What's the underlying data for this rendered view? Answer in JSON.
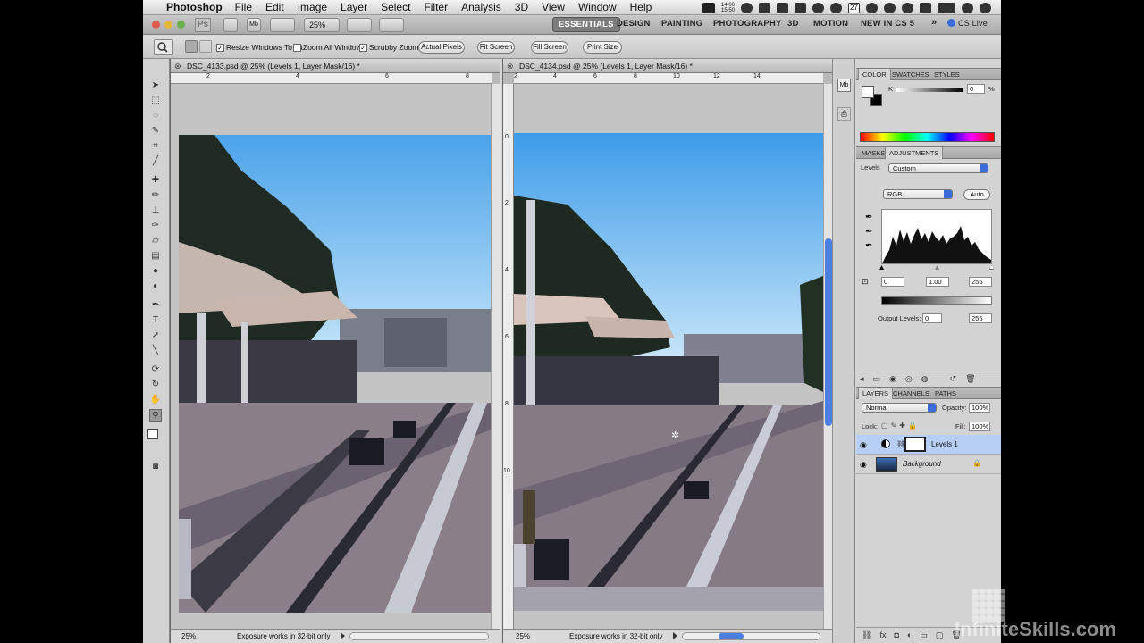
{
  "menu": {
    "app_name": "Photoshop",
    "items": [
      "File",
      "Edit",
      "Image",
      "Layer",
      "Select",
      "Filter",
      "Analysis",
      "3D",
      "View",
      "Window",
      "Help"
    ],
    "clock_lines": [
      "14:00",
      "15:50"
    ],
    "battery_label": "27"
  },
  "appbar": {
    "logo": "Ps",
    "zoom": "25%",
    "workspaces": [
      "ESSENTIALS",
      "DESIGN",
      "PAINTING",
      "PHOTOGRAPHY",
      "3D",
      "MOTION",
      "NEW IN CS 5"
    ],
    "active_workspace": "ESSENTIALS",
    "cs_live": "CS Live"
  },
  "options": {
    "checkboxes": [
      {
        "label": "Resize Windows To Fit",
        "checked": true
      },
      {
        "label": "Zoom All Windows",
        "checked": false
      },
      {
        "label": "Scrubby Zoom",
        "checked": true
      }
    ],
    "buttons": [
      "Actual Pixels",
      "Fit Screen",
      "Fill Screen",
      "Print Size"
    ]
  },
  "documents": [
    {
      "title": "DSC_4133.psd @ 25% (Levels 1, Layer Mask/16) *",
      "zoom": "25%",
      "status": "Exposure works in 32-bit only"
    },
    {
      "title": "DSC_4134.psd @ 25% (Levels 1, Layer Mask/16) *",
      "zoom": "25%",
      "status": "Exposure works in 32-bit only"
    }
  ],
  "rulers": {
    "doc1_h": [
      "2",
      "4",
      "6",
      "8"
    ],
    "doc2_h": [
      "2",
      "4",
      "6",
      "8",
      "10",
      "12",
      "14"
    ],
    "doc2_v": [
      "0",
      "2",
      "4",
      "6",
      "8",
      "10"
    ]
  },
  "color_panel": {
    "tabs": [
      "COLOR",
      "SWATCHES",
      "STYLES"
    ],
    "active_tab": "COLOR",
    "channel": "K",
    "value": "0",
    "unit": "%"
  },
  "adjustments": {
    "tabs": [
      "MASKS",
      "ADJUSTMENTS"
    ],
    "active_tab": "ADJUSTMENTS",
    "type": "Levels",
    "preset": "Custom",
    "channel": "RGB",
    "auto": "Auto",
    "input_black": "0",
    "input_gamma": "1.00",
    "input_white": "255",
    "output_label": "Output Levels:",
    "output_black": "0",
    "output_white": "255"
  },
  "layers_panel": {
    "tabs": [
      "LAYERS",
      "CHANNELS",
      "PATHS"
    ],
    "active_tab": "LAYERS",
    "blend_mode": "Normal",
    "opacity_label": "Opacity:",
    "opacity": "100%",
    "lock_label": "Lock:",
    "fill_label": "Fill:",
    "fill": "100%",
    "layers": [
      {
        "name": "Levels 1",
        "selected": true
      },
      {
        "name": "Background",
        "selected": false,
        "locked": true
      }
    ]
  },
  "watermark": "InfiniteSkills.com",
  "colors": {
    "accent": "#3b6cd9",
    "sky": "#6fb9f0",
    "selected_layer": "#b8cff5"
  }
}
